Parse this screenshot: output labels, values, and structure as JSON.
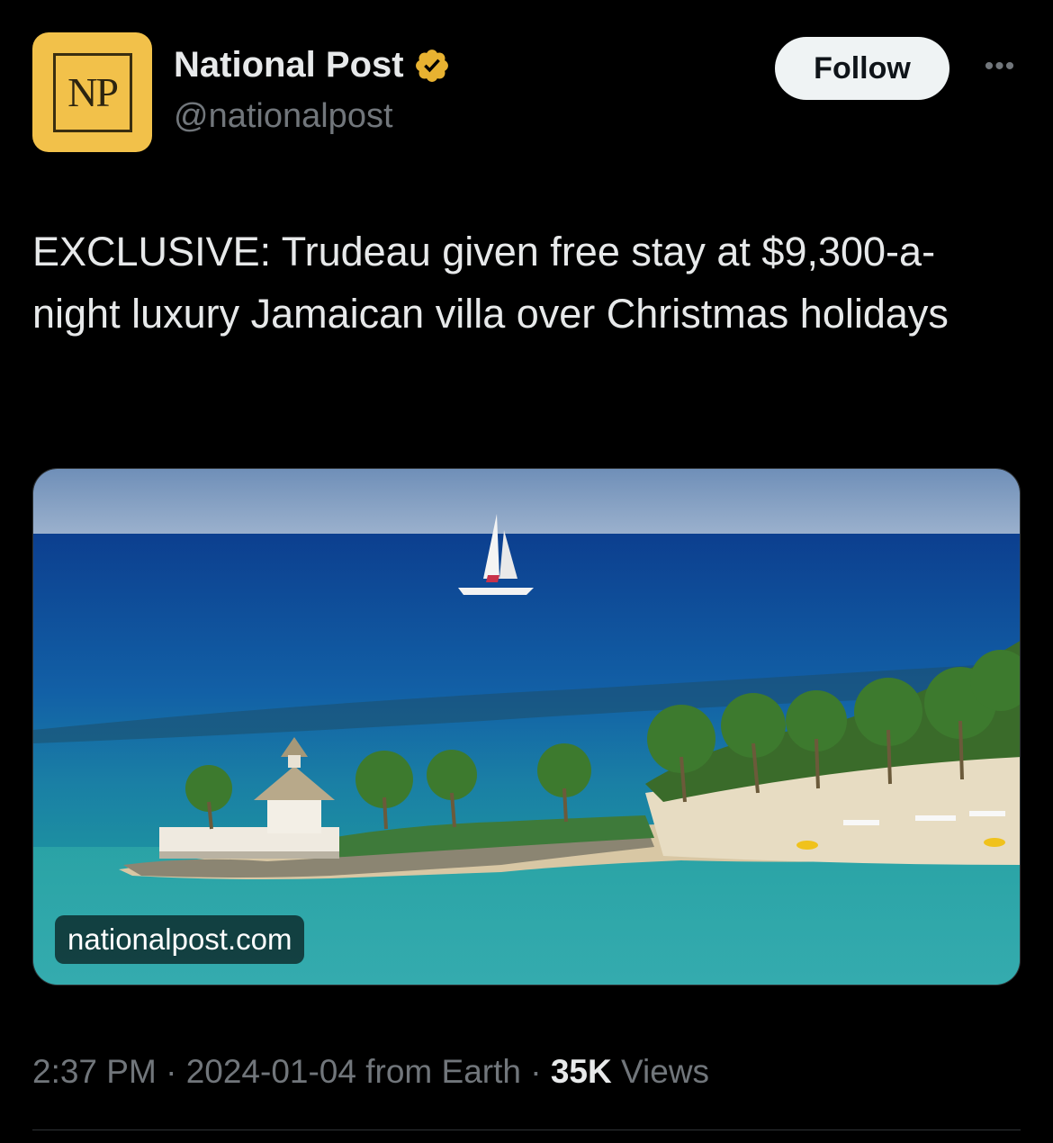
{
  "account": {
    "avatar_text": "NP",
    "display_name": "National Post",
    "handle": "@nationalpost",
    "verified_color": "#e8b231",
    "verified_icon": "verified-badge-icon"
  },
  "follow_label": "Follow",
  "more_icon": "more-dots-icon",
  "tweet": {
    "text": "EXCLUSIVE: Trudeau given free stay at $9,300-a-night luxury Jamaican villa over Christmas holidays"
  },
  "media": {
    "link_domain": "nationalpost.com"
  },
  "meta": {
    "time": "2:37 PM",
    "sep1": " · ",
    "date": "2024-01-04",
    "source": " from Earth",
    "sep2": " · ",
    "views_count": "35K",
    "views_label": " Views"
  }
}
